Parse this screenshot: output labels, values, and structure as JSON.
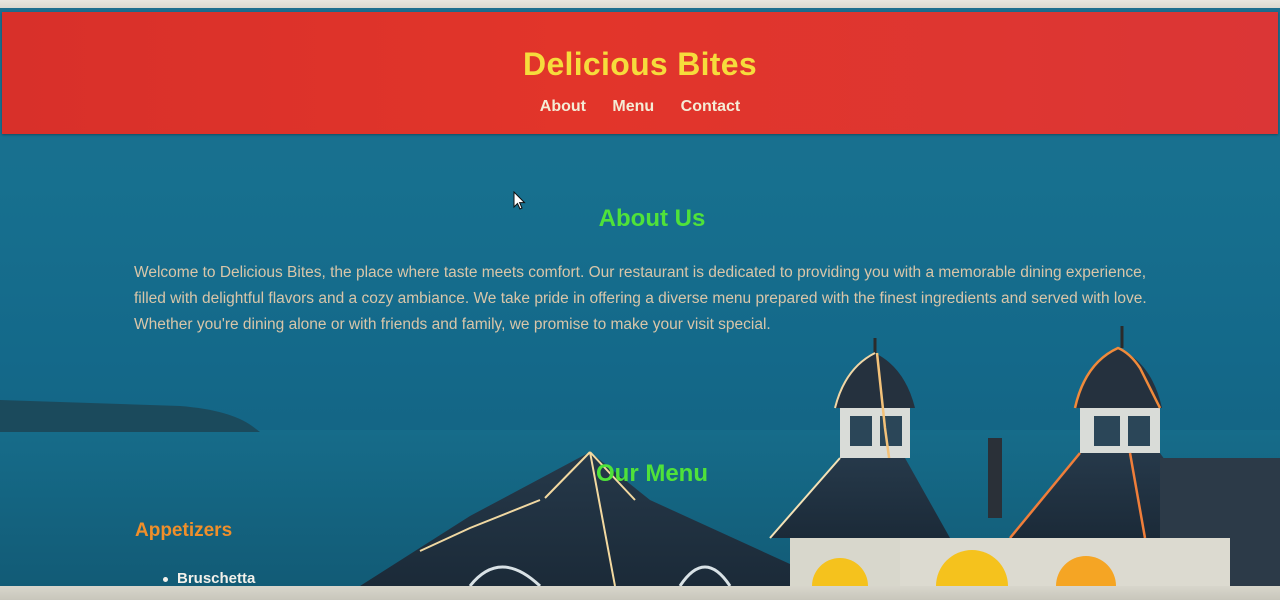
{
  "site": {
    "title": "Delicious Bites"
  },
  "nav": {
    "items": [
      "About",
      "Menu",
      "Contact"
    ]
  },
  "about": {
    "heading": "About Us",
    "text": "Welcome to Delicious Bites, the place where taste meets comfort. Our restaurant is dedicated to providing you with a memorable dining experience, filled with delightful flavors and a cozy ambiance. We take pride in offering a diverse menu prepared with the finest ingredients and served with love. Whether you're dining alone or with friends and family, we promise to make your visit special."
  },
  "menu": {
    "heading": "Our Menu",
    "categories": [
      {
        "name": "Appetizers",
        "items": [
          "Bruschetta"
        ]
      }
    ]
  },
  "colors": {
    "header_bg": "#dc322b",
    "title": "#f6dc3c",
    "section_heading": "#4fe23a",
    "category_heading": "#f08f2a",
    "body_text": "#d9c6a9",
    "page_bg": "#17708f"
  },
  "icons": {
    "cursor": "mouse-pointer-icon"
  }
}
